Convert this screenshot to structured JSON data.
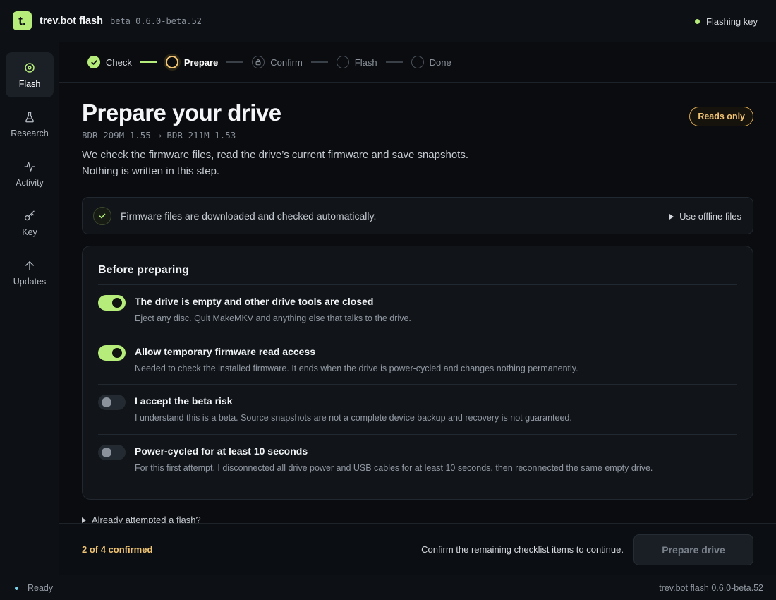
{
  "app": {
    "logo_text": "t.",
    "name": "trev.bot flash",
    "version": "beta 0.6.0-beta.52",
    "status": "Flashing key",
    "accent_color": "#b5ec7a",
    "warning_color": "#f0c473"
  },
  "sidebar": {
    "items": [
      {
        "label": "Flash",
        "icon": "target-icon",
        "active": true
      },
      {
        "label": "Research",
        "icon": "flask-icon",
        "active": false
      },
      {
        "label": "Activity",
        "icon": "activity-icon",
        "active": false
      },
      {
        "label": "Key",
        "icon": "key-icon",
        "active": false
      },
      {
        "label": "Updates",
        "icon": "arrow-up-icon",
        "active": false
      }
    ]
  },
  "stepper": {
    "steps": [
      {
        "label": "Check",
        "state": "done"
      },
      {
        "label": "Prepare",
        "state": "current"
      },
      {
        "label": "Confirm",
        "state": "locked"
      },
      {
        "label": "Flash",
        "state": "pending"
      },
      {
        "label": "Done",
        "state": "pending"
      }
    ]
  },
  "page": {
    "title": "Prepare your drive",
    "drive": "BDR-209M 1.55 → BDR-211M 1.53",
    "description_line1": "We check the firmware files, read the drive’s current firmware and save snapshots.",
    "description_line2": "Nothing is written in this step.",
    "badge": "Reads only"
  },
  "firmware": {
    "message": "Firmware files are downloaded and checked automatically.",
    "offline_link": "Use offline files"
  },
  "checklist": {
    "title": "Before preparing",
    "items": [
      {
        "title": "The drive is empty and other drive tools are closed",
        "description": "Eject any disc. Quit MakeMKV and anything else that talks to the drive.",
        "checked": true
      },
      {
        "title": "Allow temporary firmware read access",
        "description": "Needed to check the installed firmware. It ends when the drive is power-cycled and changes nothing permanently.",
        "checked": true
      },
      {
        "title": "I accept the beta risk",
        "description": "I understand this is a beta. Source snapshots are not a complete device backup and recovery is not guaranteed.",
        "checked": false
      },
      {
        "title": "Power-cycled for at least 10 seconds",
        "description": "For this first attempt, I disconnected all drive power and USB cables for at least 10 seconds, then reconnected the same empty drive.",
        "checked": false
      }
    ]
  },
  "attempted_link": "Already attempted a flash?",
  "footer": {
    "confirmed": "2 of 4 confirmed",
    "message": "Confirm the remaining checklist items to continue.",
    "button": "Prepare drive"
  },
  "statusbar": {
    "left": "Ready",
    "right": "trev.bot flash 0.6.0-beta.52"
  }
}
